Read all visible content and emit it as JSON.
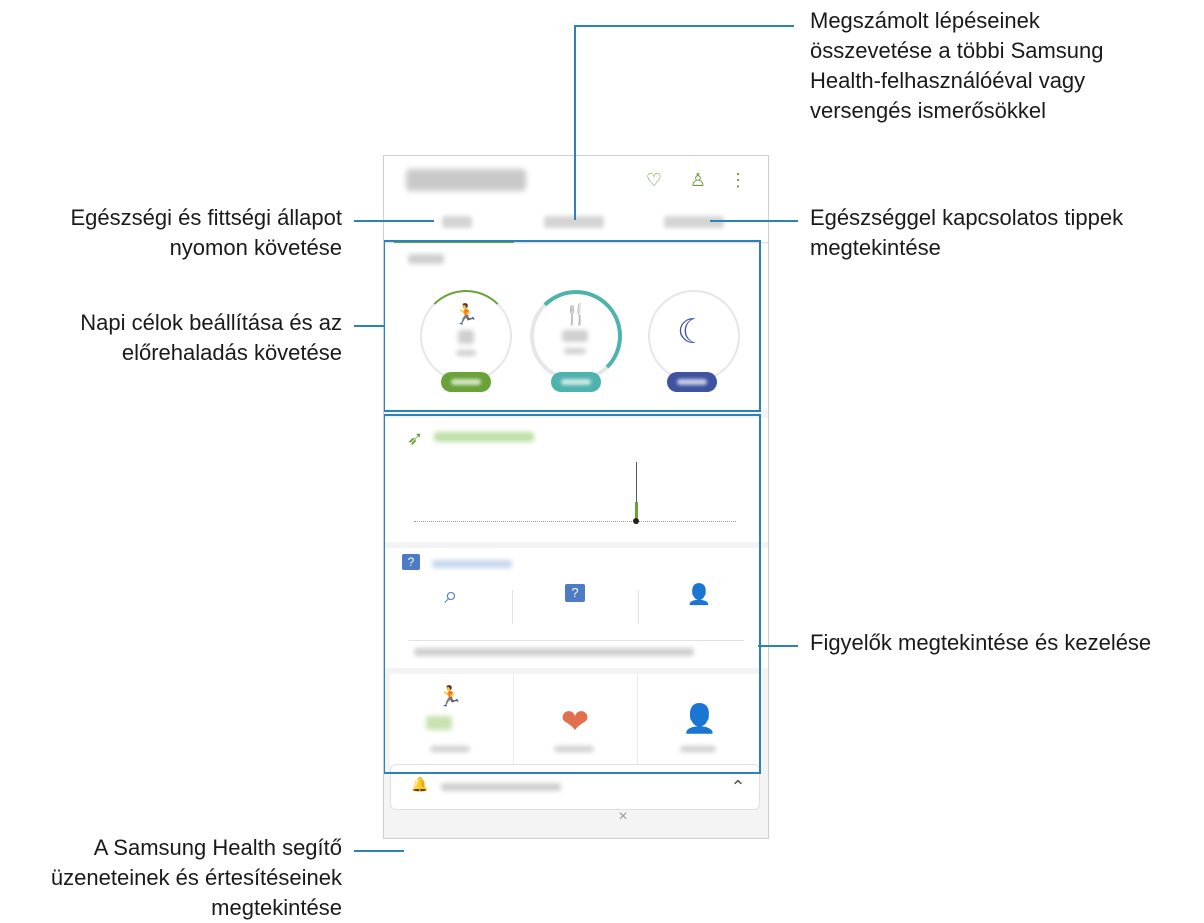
{
  "annotations": {
    "top_right": [
      "Megszámolt lépéseinek",
      "összevetése a többi Samsung",
      "Health-felhasználóéval vagy",
      "versengés ismerősökkel"
    ],
    "left_1": [
      "Egészségi és fittségi állapot",
      "nyomon követése"
    ],
    "right_1": [
      "Egészséggel kapcsolatos tippek",
      "megtekintése"
    ],
    "left_2": [
      "Napi célok beállítása és az",
      "előrehaladás követése"
    ],
    "right_2": [
      "Figyelők megtekintése és kezelése"
    ],
    "left_3": [
      "A Samsung Health segítő",
      "üzeneteinek és értesítéseinek",
      "megtekintése"
    ]
  },
  "colors": {
    "callout_line": "#2a82b8",
    "accent_green": "#6aa23a",
    "food_teal": "#4fb3ad",
    "sleep_blue": "#3f53a0",
    "stress_orange": "#e2704f"
  },
  "icons": {
    "header": [
      "lightbulb-icon",
      "person-icon",
      "more-vert-icon"
    ],
    "quick": [
      "search-icon",
      "question-icon",
      "expert-icon"
    ],
    "msgbar": [
      "bell-icon",
      "chevron-up-icon"
    ],
    "trackers": [
      "run-icon",
      "heart-icon",
      "stress-icon"
    ]
  },
  "glyphs": {
    "lightbulb": "♡",
    "person": "♙",
    "more": "⋮",
    "run": "🏃",
    "fork": "🍴",
    "moon": "☾",
    "shoe": "➶",
    "question": "?",
    "search": "⌕",
    "expert": "👤",
    "heart": "❤",
    "stress": "👤",
    "close": "×",
    "bell": "🔔",
    "chevron_up": "⌃"
  }
}
